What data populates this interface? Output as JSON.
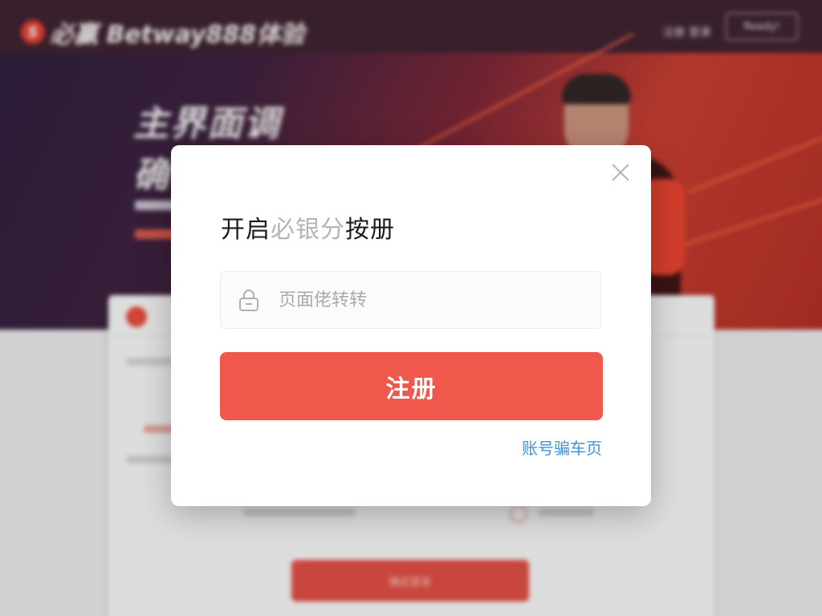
{
  "background": {
    "logo_mark": "S",
    "logo_text": "必赢 Betway888体验",
    "nav_link": "注册 登录",
    "nav_button": "Ready!",
    "hero_title_line1": "主界面调",
    "hero_title_line2": "确",
    "panel_button": "确定登录"
  },
  "modal": {
    "title_prefix": "开启",
    "title_muted": "必银分",
    "title_suffix": "按册",
    "input": {
      "placeholder": "页面佬转转",
      "value": ""
    },
    "register_label": "注册",
    "help_link": "账号骗车页"
  },
  "colors": {
    "accent": "#f0584c",
    "link": "#3d94dd",
    "title_muted": "#b9b3b3"
  },
  "icons": {
    "close": "close-icon",
    "input": "lock-icon"
  }
}
